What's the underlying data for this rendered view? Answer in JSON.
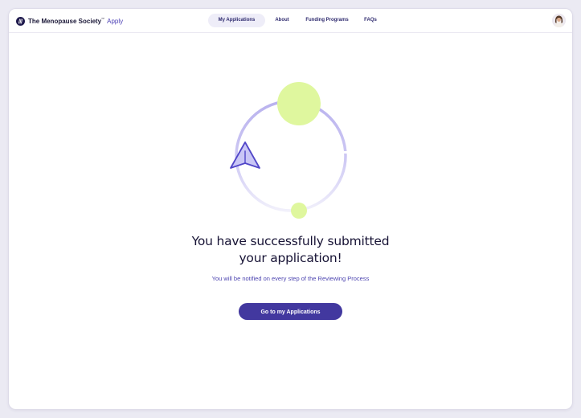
{
  "brand": {
    "name": "The Menopause Society",
    "trademark": "™",
    "product": "Apply"
  },
  "nav": {
    "items": [
      {
        "label": "My Applications",
        "active": true
      },
      {
        "label": "About",
        "active": false
      },
      {
        "label": "Funding Programs",
        "active": false
      },
      {
        "label": "FAQs",
        "active": false
      }
    ]
  },
  "confirmation": {
    "title_line1": "You have successfully submitted",
    "title_line2": "your application!",
    "subtitle": "You will be notified on every step of the Reviewing Process",
    "button_label": "Go to my Applications"
  },
  "icons": {
    "illustration": "paper-plane-icon",
    "logo": "brand-logo-icon",
    "avatar": "user-avatar"
  },
  "colors": {
    "accent": "#42389f",
    "accent_text": "#4d45b0",
    "lime": "#dff79e",
    "ring": "#c9c3f2",
    "plane_fill": "#c9c6f6",
    "plane_stroke": "#5146c8",
    "title": "#171335"
  }
}
